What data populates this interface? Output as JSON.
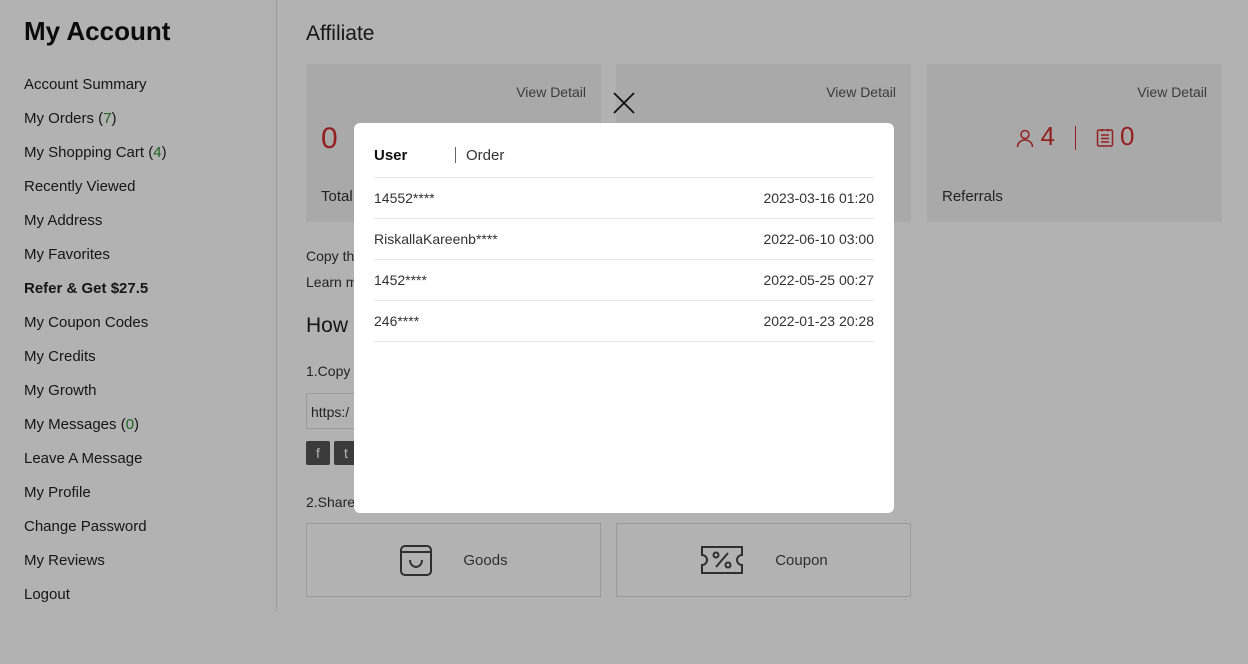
{
  "sidebar": {
    "title": "My Account",
    "items": [
      {
        "label": "Account Summary"
      },
      {
        "label": "My Orders",
        "count": "7"
      },
      {
        "label": "My Shopping Cart",
        "count": "4"
      },
      {
        "label": "Recently Viewed"
      },
      {
        "label": "My Address"
      },
      {
        "label": "My Favorites"
      },
      {
        "label": "Refer & Get $27.5"
      },
      {
        "label": "My Coupon Codes"
      },
      {
        "label": "My Credits"
      },
      {
        "label": "My Growth"
      },
      {
        "label": "My Messages",
        "count": "0"
      },
      {
        "label": "Leave A Message"
      },
      {
        "label": "My Profile"
      },
      {
        "label": "Change Password"
      },
      {
        "label": "My Reviews"
      },
      {
        "label": "Logout"
      }
    ]
  },
  "main": {
    "title": "Affiliate",
    "cards": [
      {
        "view_detail": "View Detail",
        "value": "0",
        "label": "Total"
      },
      {
        "view_detail": "View Detail"
      },
      {
        "view_detail": "View Detail",
        "users": "4",
        "orders": "0",
        "label": "Referrals"
      }
    ],
    "copy_text": "Copy th",
    "learn_text": "Learn m",
    "how_title": "How",
    "step1": "1.Copy",
    "url_partial": "https:/",
    "step2": "2.Share",
    "share_goods": "Goods",
    "share_coupon": "Coupon"
  },
  "modal": {
    "tabs": [
      "User",
      "Order"
    ],
    "rows": [
      {
        "user": "14552****",
        "date": "2023-03-16 01:20"
      },
      {
        "user": "RiskallaKareenb****",
        "date": "2022-06-10 03:00"
      },
      {
        "user": "1452****",
        "date": "2022-05-25 00:27"
      },
      {
        "user": "246****",
        "date": "2022-01-23 20:28"
      }
    ]
  },
  "colors": {
    "accent": "#d32f2f",
    "count_green": "#2e8b2e"
  },
  "icons": [
    "user-icon",
    "order-icon",
    "shopping-bag-icon",
    "coupon-percent-icon",
    "facebook-icon",
    "twitter-icon",
    "close-icon"
  ]
}
